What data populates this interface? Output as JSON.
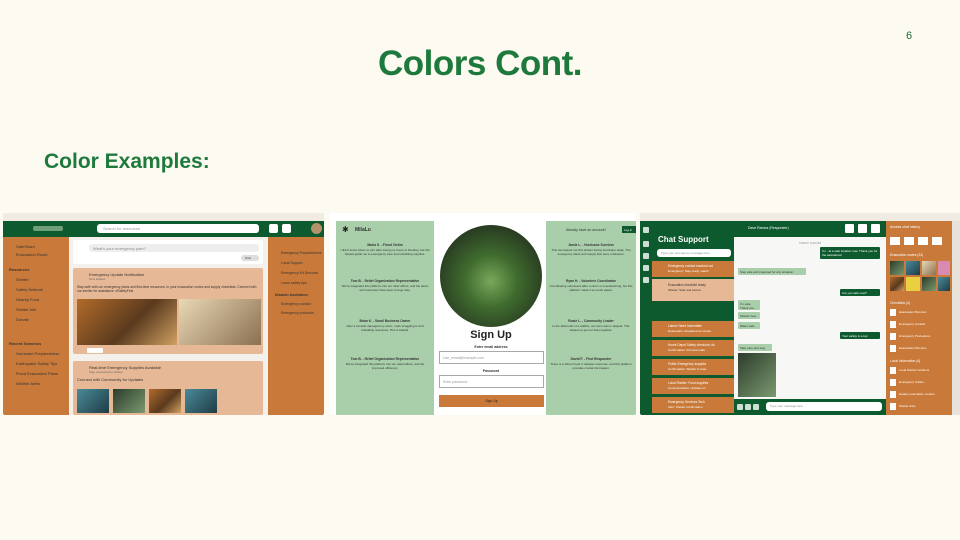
{
  "slide": {
    "page_number": "6",
    "title": "Colors Cont.",
    "subtitle": "Color Examples:"
  },
  "colors": {
    "title_green": "#1e7a3c",
    "dark_green": "#0d5a2f",
    "orange": "#c97a3a",
    "peach": "#e7b895",
    "mint": "#a9cfaa",
    "background": "#fdfaf1"
  },
  "feed_screen": {
    "search_placeholder": "Search for resources",
    "post_placeholder": "What's your emergency plan?",
    "post_button": "Post",
    "sidebar_top": [
      "SafeShare",
      "Evacuation Route"
    ],
    "resources_header": "Resources",
    "resources": [
      "Shelter",
      "Safety Network",
      "Nearby Food",
      "Shelter info",
      "Donate"
    ],
    "recent_header": "Recent Searches",
    "recent": [
      "Hurricane Preparedness",
      "Earthquake Safety Tips",
      "Flood Evacuation Plans",
      "Wildfire Alerts"
    ],
    "post1_title": "Emergency Update Notification",
    "post1_meta": "Now shared",
    "post1_body": "Stay safe with our emergency plans and first-time resources. In your evacuation routes and supply checklists. Connect with our shelter for assistance. #SafetyFirst",
    "post2_title": "Real-time Emergency Supplies Available",
    "post2_meta": "Stay connected to shelter",
    "post2_body": "Connect with Community for Updates",
    "right_items": [
      "Emergency Preparedness",
      "Local Support",
      "Emergency Kit Services",
      "Learn safety tips"
    ],
    "right_header": "Disaster Assistance",
    "right_items2": [
      "Emergency contact",
      "Emergency protocols"
    ]
  },
  "signup_screen": {
    "brand": "MilaLu",
    "login_prompt": "Already have an account?",
    "login_button": "Log in",
    "heading": "Sign Up",
    "email_label": "Enter email address",
    "email_placeholder": "Use_email@example.com",
    "password_label": "Password",
    "password_placeholder": "Enter password",
    "button": "Sign Up",
    "left_testimonials": [
      {
        "name": "Maria S. - Flood Victim",
        "text": "I didn't know where to turn after losing my home to flooding, but this helped guide me to emergency care and rebuilding supplies."
      },
      {
        "name": "Tom B. - Relief Organization Representative",
        "text": "We've integrated this platform into our relief efforts, and the alerts and resources have been a huge help."
      },
      {
        "name": "Brian K. - Small Business Owner",
        "text": "After a tornado damaged my store, I was struggling to find rebuilding resources. This is helpful."
      },
      {
        "name": "Tom B. - Relief Organization Representative",
        "text": "We've integrated this platform into our relief efforts, and the improved efficiency."
      }
    ],
    "right_testimonials": [
      {
        "name": "Jamie L. - Hurricane Survivor",
        "text": "This site helped me find shelter during Hurricane Isaac. The emergency alerts and supply lists were a lifesaver."
      },
      {
        "name": "Ryan H. - Volunteer Coordinator",
        "text": "Coordinating volunteers after a storm is overwhelming, but this platform made it so much easier."
      },
      {
        "name": "Rosie L. - Community Leader",
        "text": "In the aftermath of a wildfire, our town was in despair. This helped us get our lives together."
      },
      {
        "name": "David F. - First Responder",
        "text": "There is a Direct Feed in disaster response, and this platform provides crucial information."
      }
    ]
  },
  "chat_screen": {
    "header_name": "Dave Ramos (Responder)",
    "title": "Chat Support",
    "search_placeholder": "Type your emergency message here",
    "conversations": [
      {
        "name": "Emergency contact reached out",
        "sub": "Emergency: Stay ready, watch"
      },
      {
        "name": "Evacuation checklist ready",
        "sub": "Shelter: Safe and secure"
      },
      {
        "name": "Latest: Need Immediate",
        "sub": "Evacuation: Area/area for routes"
      },
      {
        "name": "Home Depot Safety checkout: do",
        "sub": "Confirmation: Personal safe"
      },
      {
        "name": "Public Emergency supplies",
        "sub": "Confirmation: Shelter in area"
      },
      {
        "name": "Local Shelter: Food supplies",
        "sub": "Communication: Updates on"
      },
      {
        "name": "Emergency Services Tech",
        "sub": "Alert: Shelter confirmation"
      }
    ],
    "date_sep": "TODAY 3:30 PM",
    "messages": [
      {
        "side": "out",
        "text": "I'm - at a safe location now. Thank you for the assistance!"
      },
      {
        "side": "in",
        "text": "Stay safe and prepared for any situation."
      },
      {
        "side": "out",
        "text": "Are you safe now?"
      },
      {
        "side": "in",
        "text": "I'm safe. Thank you."
      },
      {
        "side": "in",
        "text": "Shelter here"
      },
      {
        "side": "in",
        "text": "Water safe"
      },
      {
        "side": "out",
        "text": "Your safety is a top"
      },
      {
        "side": "in",
        "text": "Take care and stay"
      }
    ],
    "input_placeholder": "Type your message here",
    "right_header": "Access chat history",
    "right_sub": "Evacuation routes (24)",
    "docs_header": "Checklists (4)",
    "docs": [
      "Evacuation Plan.doc",
      "Emergency Contact",
      "Emergency Procedures",
      "Evacuation Plan.doc"
    ],
    "links_header": "Local Information (4)",
    "links": [
      "Local Shelter locations",
      "Emergency hotline",
      "Nearby evacuation centers",
      "Shelter links"
    ]
  }
}
